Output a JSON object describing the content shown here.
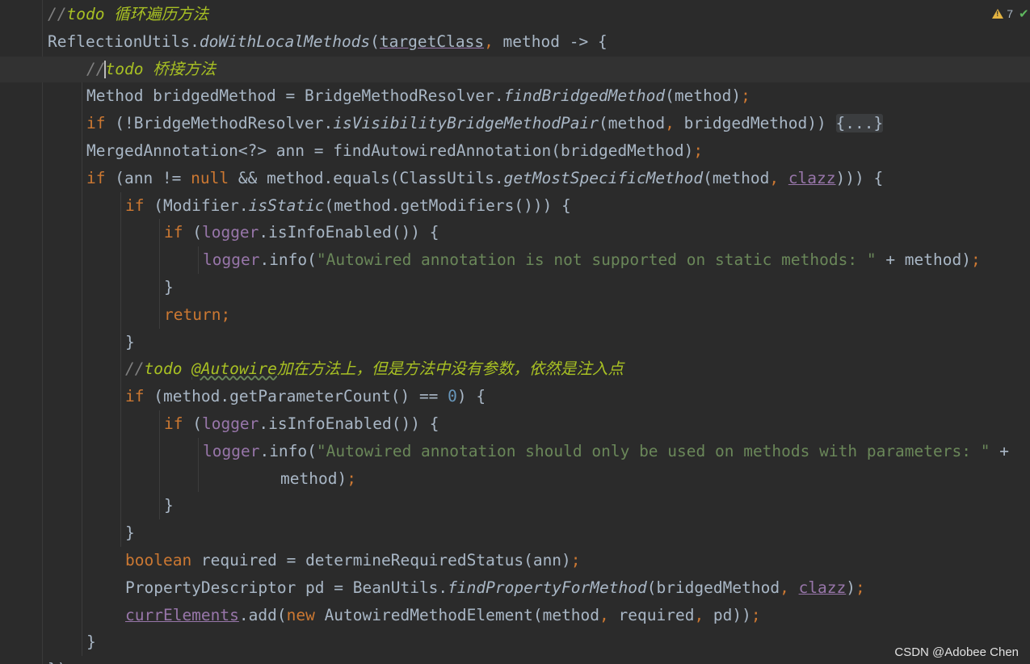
{
  "editor": {
    "status": {
      "warning_count": "7",
      "warning_icon": "warning-triangle-icon",
      "check_icon": "checkmark-icon"
    },
    "colors": {
      "background": "#2b2b2b",
      "keyword": "#cc7832",
      "string": "#6a8759",
      "field": "#9876aa",
      "comment": "#808080",
      "todo": "#a8c023",
      "number": "#6897bb",
      "text": "#a9b7c6"
    },
    "lines": [
      {
        "indent": 1,
        "tokens": [
          [
            "//",
            "comment"
          ],
          [
            "todo 循环遍历方法",
            "todo"
          ]
        ]
      },
      {
        "indent": 1,
        "tokens": [
          [
            "ReflectionUtils.",
            "plain"
          ],
          [
            "doWithLocalMethods",
            "italic"
          ],
          [
            "(",
            "plain"
          ],
          [
            "targetClass",
            "plain ul"
          ],
          [
            ", ",
            "punct"
          ],
          [
            "method -> {",
            "plain"
          ]
        ]
      },
      {
        "indent": 2,
        "caret": true,
        "tokens": [
          [
            "//",
            "comment"
          ],
          [
            "todo 桥接方法",
            "todo"
          ]
        ]
      },
      {
        "indent": 2,
        "tokens": [
          [
            "Method bridgedMethod = BridgeMethodResolver.",
            "plain"
          ],
          [
            "findBridgedMethod",
            "italic"
          ],
          [
            "(method)",
            "plain"
          ],
          [
            ";",
            "punct"
          ]
        ]
      },
      {
        "indent": 2,
        "tokens": [
          [
            "if",
            "kw"
          ],
          [
            " (!BridgeMethodResolver.",
            "plain"
          ],
          [
            "isVisibilityBridgeMethodPair",
            "italic"
          ],
          [
            "(method",
            "plain"
          ],
          [
            ", ",
            "punct"
          ],
          [
            "bridgedMethod)) ",
            "plain"
          ],
          [
            "{...}",
            "fold"
          ]
        ]
      },
      {
        "indent": 2,
        "tokens": [
          [
            "MergedAnnotation<?> ann = findAutowiredAnnotation(bridgedMethod)",
            "plain"
          ],
          [
            ";",
            "punct"
          ]
        ]
      },
      {
        "indent": 2,
        "tokens": [
          [
            "if",
            "kw"
          ],
          [
            " (ann != ",
            "plain"
          ],
          [
            "null",
            "kw"
          ],
          [
            " && method.equals(ClassUtils.",
            "plain"
          ],
          [
            "getMostSpecificMethod",
            "italic"
          ],
          [
            "(method",
            "plain"
          ],
          [
            ", ",
            "punct"
          ],
          [
            "clazz",
            "field ul"
          ],
          [
            "))) {",
            "plain"
          ]
        ]
      },
      {
        "indent": 3,
        "tokens": [
          [
            "if",
            "kw"
          ],
          [
            " (Modifier.",
            "plain"
          ],
          [
            "isStatic",
            "italic"
          ],
          [
            "(method.getModifiers())) {",
            "plain"
          ]
        ]
      },
      {
        "indent": 4,
        "tokens": [
          [
            "if",
            "kw"
          ],
          [
            " (",
            "plain"
          ],
          [
            "logger",
            "field"
          ],
          [
            ".isInfoEnabled()) {",
            "plain"
          ]
        ]
      },
      {
        "indent": 5,
        "tokens": [
          [
            "logger",
            "field"
          ],
          [
            ".info(",
            "plain"
          ],
          [
            "\"Autowired annotation is not supported on static methods: \"",
            "str"
          ],
          [
            " + method)",
            "plain"
          ],
          [
            ";",
            "punct"
          ]
        ]
      },
      {
        "indent": 4,
        "tokens": [
          [
            "}",
            "plain"
          ]
        ]
      },
      {
        "indent": 4,
        "tokens": [
          [
            "return;",
            "kw"
          ]
        ]
      },
      {
        "indent": 3,
        "tokens": [
          [
            "}",
            "plain"
          ]
        ]
      },
      {
        "indent": 3,
        "tokens": [
          [
            "//",
            "comment"
          ],
          [
            "todo ",
            "todo"
          ],
          [
            "@Autowire",
            "todo wavy"
          ],
          [
            "加在方法上，但是方法中没有参数，依然是注入点",
            "todo cjk"
          ]
        ]
      },
      {
        "indent": 3,
        "tokens": [
          [
            "if",
            "kw"
          ],
          [
            " (method.getParameterCount() == ",
            "plain"
          ],
          [
            "0",
            "num"
          ],
          [
            ") {",
            "plain"
          ]
        ]
      },
      {
        "indent": 4,
        "tokens": [
          [
            "if",
            "kw"
          ],
          [
            " (",
            "plain"
          ],
          [
            "logger",
            "field"
          ],
          [
            ".isInfoEnabled()) {",
            "plain"
          ]
        ]
      },
      {
        "indent": 5,
        "tokens": [
          [
            "logger",
            "field"
          ],
          [
            ".info(",
            "plain"
          ],
          [
            "\"Autowired annotation should only be used on methods with parameters: \"",
            "str"
          ],
          [
            " +",
            "plain"
          ]
        ]
      },
      {
        "indent": 7,
        "tokens": [
          [
            "method)",
            "plain"
          ],
          [
            ";",
            "punct"
          ]
        ]
      },
      {
        "indent": 4,
        "tokens": [
          [
            "}",
            "plain"
          ]
        ]
      },
      {
        "indent": 3,
        "tokens": [
          [
            "}",
            "plain"
          ]
        ]
      },
      {
        "indent": 3,
        "tokens": [
          [
            "boolean",
            "kw"
          ],
          [
            " required = determineRequiredStatus(ann)",
            "plain"
          ],
          [
            ";",
            "punct"
          ]
        ]
      },
      {
        "indent": 3,
        "tokens": [
          [
            "PropertyDescriptor pd = BeanUtils.",
            "plain"
          ],
          [
            "findPropertyForMethod",
            "italic"
          ],
          [
            "(bridgedMethod",
            "plain"
          ],
          [
            ", ",
            "punct"
          ],
          [
            "clazz",
            "field ul"
          ],
          [
            ")",
            "plain"
          ],
          [
            ";",
            "punct"
          ]
        ]
      },
      {
        "indent": 3,
        "tokens": [
          [
            "currElements",
            "field ul"
          ],
          [
            ".add(",
            "plain"
          ],
          [
            "new",
            "kw"
          ],
          [
            " AutowiredMethodElement(method",
            "plain"
          ],
          [
            ", ",
            "punct"
          ],
          [
            "required",
            "plain"
          ],
          [
            ", ",
            "punct"
          ],
          [
            "pd))",
            "plain"
          ],
          [
            ";",
            "punct"
          ]
        ]
      },
      {
        "indent": 2,
        "tokens": [
          [
            "}",
            "plain"
          ]
        ]
      },
      {
        "indent": 1,
        "tokens": [
          [
            "});",
            "plain"
          ]
        ]
      }
    ]
  },
  "watermark": "CSDN @Adobee Chen"
}
